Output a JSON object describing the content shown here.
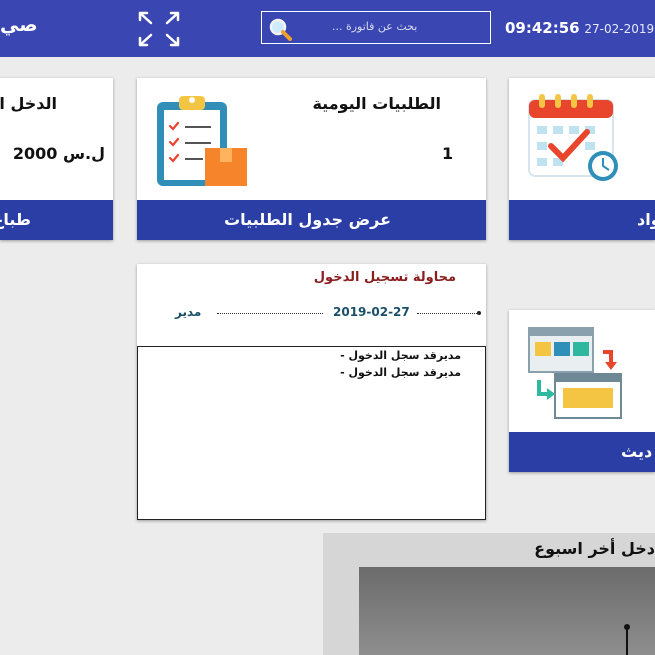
{
  "header": {
    "brand_partial": "صي",
    "search_placeholder": "بحث عن فاتورة ...",
    "time": "09:42:56",
    "date": "27-02-2019",
    "accent": "#3a47b3"
  },
  "cards": {
    "income": {
      "title_partial": "الدخل ال",
      "value": "2000 ل.س",
      "footer_partial": "طباع"
    },
    "orders": {
      "title": "الطلبيات اليومية",
      "value": "1",
      "footer": "عرض جدول الطلبيات"
    },
    "materials": {
      "footer_partial": "واد"
    },
    "update": {
      "footer_partial": "ديث"
    }
  },
  "login_panel": {
    "title": "محاولة تسجيل الدخول",
    "date": "2019-02-27",
    "role": "مدير",
    "entries": [
      "مديرقد سجل الدخول -",
      "مديرقد سجل الدخول -"
    ]
  },
  "chart": {
    "title_partial": "دخل أخر اسبوع"
  },
  "chart_data": {
    "type": "line",
    "title": "دخل أخر اسبوع",
    "series": []
  },
  "icons": {
    "expand": "expand-icon",
    "search": "search-icon",
    "clipboard": "clipboard-checklist-icon",
    "calendar": "calendar-check-icon",
    "sync": "sync-windows-icon"
  }
}
